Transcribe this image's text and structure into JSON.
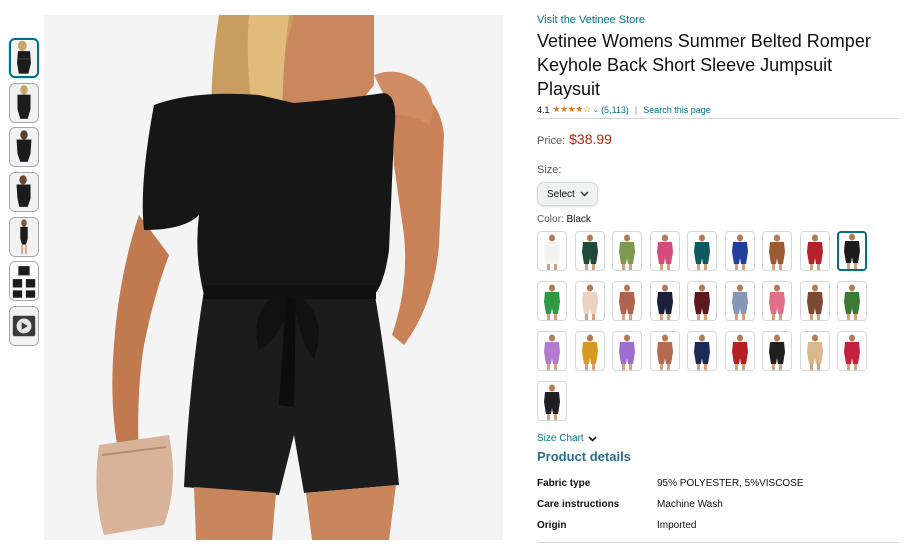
{
  "store_link": "Visit the Vetinee Store",
  "title": "Vetinee Womens Summer Belted Romper Keyhole Back Short Sleeve Jumpsuit Playsuit",
  "rating": {
    "value": "4.1",
    "stars": "★★★★☆",
    "count": "(5,113)",
    "separator": "|",
    "search_link": "Search this page"
  },
  "price": {
    "label": "Price:",
    "value": "$38.99"
  },
  "size": {
    "label": "Size:",
    "select_label": "Select"
  },
  "color": {
    "label": "Color:",
    "selected": "Black"
  },
  "swatches": [
    {
      "name": "white",
      "color": "#f4f4f4"
    },
    {
      "name": "dark-green",
      "color": "#1f4a3a"
    },
    {
      "name": "olive",
      "color": "#7b9a4e"
    },
    {
      "name": "pink",
      "color": "#d24c7c"
    },
    {
      "name": "teal",
      "color": "#0f5a5f"
    },
    {
      "name": "royal-blue",
      "color": "#233f9c"
    },
    {
      "name": "brown",
      "color": "#9a5a33"
    },
    {
      "name": "red",
      "color": "#b3222a"
    },
    {
      "name": "black",
      "color": "#1b1b1b",
      "selected": true
    },
    {
      "name": "green",
      "color": "#2f9a46"
    },
    {
      "name": "beige",
      "color": "#ead2c2"
    },
    {
      "name": "rose-brown",
      "color": "#b06250"
    },
    {
      "name": "navy",
      "color": "#1a1f3a"
    },
    {
      "name": "maroon",
      "color": "#5c1a1f"
    },
    {
      "name": "grey-blue",
      "color": "#8497b5"
    },
    {
      "name": "rose-pink",
      "color": "#e26f88"
    },
    {
      "name": "coffee",
      "color": "#7a4a32"
    },
    {
      "name": "forest-green",
      "color": "#3b7a33"
    },
    {
      "name": "lavender",
      "color": "#b07bd0"
    },
    {
      "name": "mustard",
      "color": "#d69a22"
    },
    {
      "name": "lilac",
      "color": "#9b6fcf"
    },
    {
      "name": "terracotta",
      "color": "#b36a4e"
    },
    {
      "name": "dark-navy",
      "color": "#1c2a55"
    },
    {
      "name": "crimson",
      "color": "#b51f24"
    },
    {
      "name": "black-2",
      "color": "#202020"
    },
    {
      "name": "tan",
      "color": "#d9b88e"
    },
    {
      "name": "raspberry",
      "color": "#c6203f"
    },
    {
      "name": "black-3",
      "color": "#1e1e24"
    }
  ],
  "size_chart": "Size Chart",
  "product_details": {
    "title": "Product details",
    "rows": [
      {
        "key": "Fabric type",
        "value": "95% POLYESTER, 5%VISCOSE"
      },
      {
        "key": "Care instructions",
        "value": "Machine Wash"
      },
      {
        "key": "Origin",
        "value": "Imported"
      }
    ]
  },
  "icons": {
    "share": "share-icon",
    "chevron": "chevron-down-icon",
    "video": "play-icon"
  }
}
